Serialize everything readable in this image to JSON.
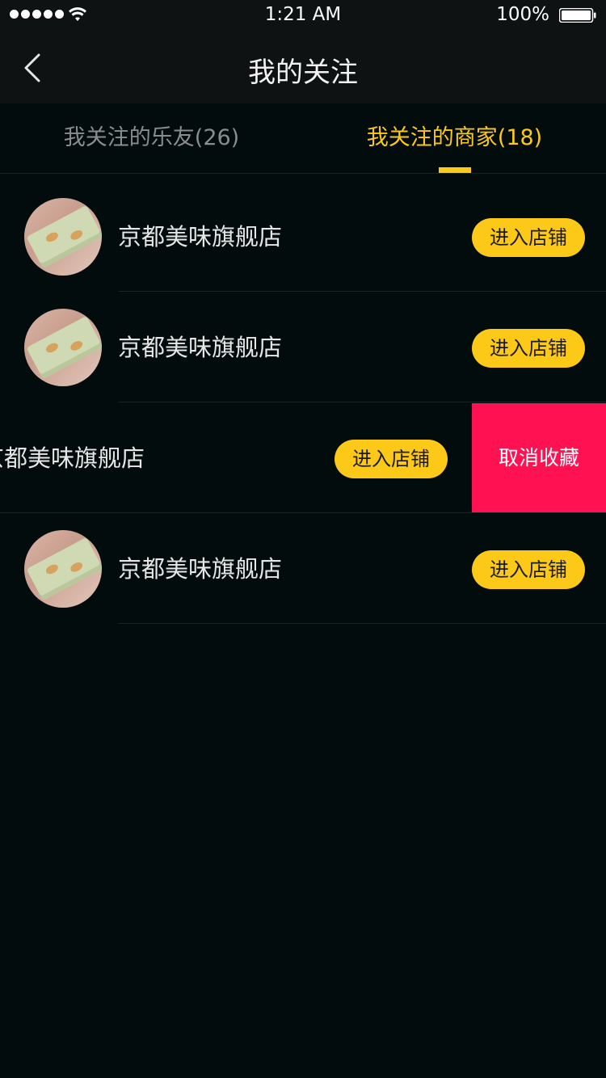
{
  "status_bar": {
    "time": "1:21 AM",
    "battery": "100%"
  },
  "nav": {
    "title": "我的关注",
    "back_icon": "chevron-left-icon"
  },
  "tabs": [
    {
      "label": "我关注的乐友(26)",
      "active": false
    },
    {
      "label": "我关注的商家(18)",
      "active": true
    }
  ],
  "shops": [
    {
      "name": "京都美味旗舰店",
      "button": "进入店铺"
    },
    {
      "name": "京都美味旗舰店",
      "button": "进入店铺"
    },
    {
      "name": "京都美味旗舰店",
      "button": "进入店铺",
      "swipe_action": "取消收藏"
    },
    {
      "name": "京都美味旗舰店",
      "button": "进入店铺"
    }
  ],
  "colors": {
    "accent": "#fcc918",
    "danger": "#ff1152",
    "background": "#020c0d"
  }
}
